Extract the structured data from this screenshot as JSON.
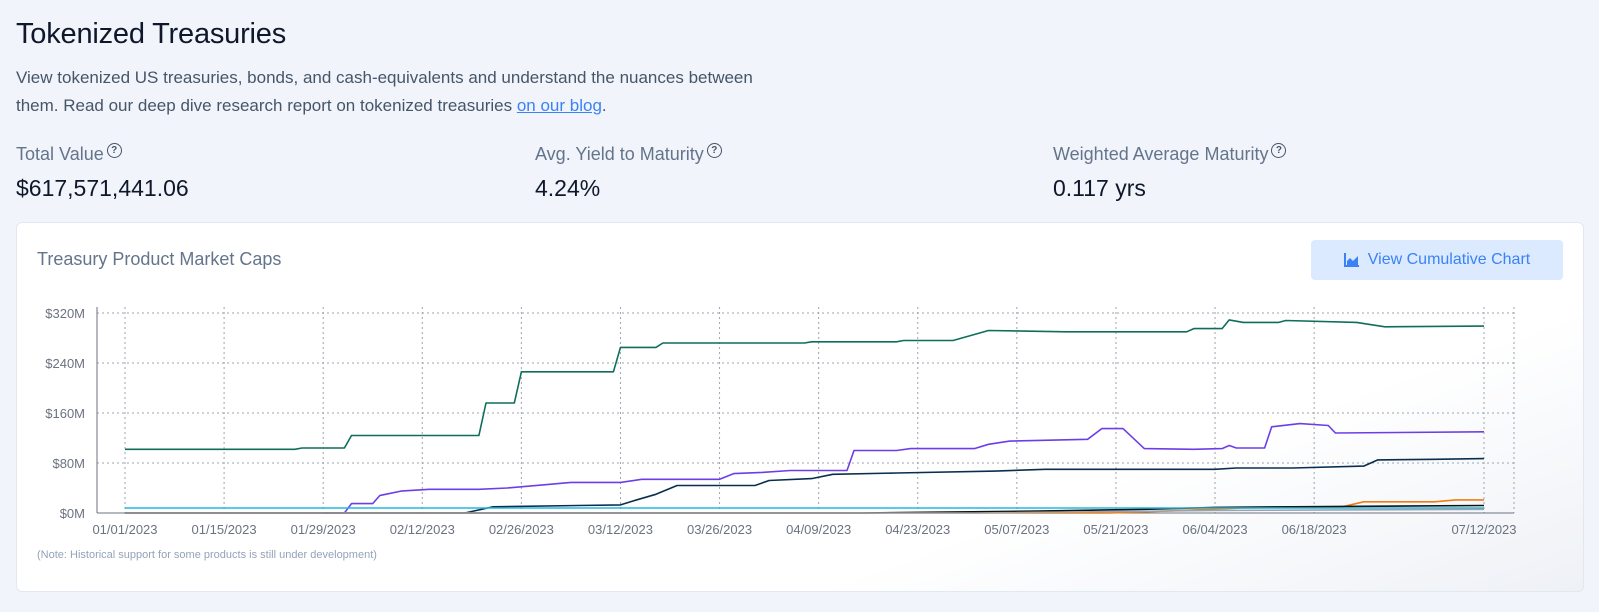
{
  "header": {
    "title": "Tokenized Treasuries",
    "description_prefix": "View tokenized US treasuries, bonds, and cash-equivalents and understand the nuances between them. Read our deep dive research report on tokenized treasuries ",
    "link_text": "on our blog",
    "description_suffix": "."
  },
  "stats": [
    {
      "label": "Total Value",
      "value": "$617,571,441.06"
    },
    {
      "label": "Avg. Yield to Maturity",
      "value": "4.24%"
    },
    {
      "label": "Weighted Average Maturity",
      "value": "0.117 yrs"
    }
  ],
  "help_glyph": "?",
  "card": {
    "title": "Treasury Product Market Caps",
    "cumulative_button": "View Cumulative Chart",
    "note": "(Note: Historical support for some products is still under development)"
  },
  "colors": {
    "accent": "#3b82f6",
    "button_bg": "#dbeafe"
  },
  "chart_data": {
    "type": "line",
    "x_start": "2023-01-01",
    "x_end": "2023-07-12",
    "x_ticks": [
      "01/01/2023",
      "01/15/2023",
      "01/29/2023",
      "02/12/2023",
      "02/26/2023",
      "03/12/2023",
      "03/26/2023",
      "04/09/2023",
      "04/23/2023",
      "05/07/2023",
      "05/21/2023",
      "06/04/2023",
      "06/18/2023",
      "07/12/2023"
    ],
    "x_tick_dates": [
      "2023-01-01",
      "2023-01-15",
      "2023-01-29",
      "2023-02-12",
      "2023-02-26",
      "2023-03-12",
      "2023-03-26",
      "2023-04-09",
      "2023-04-23",
      "2023-05-07",
      "2023-05-21",
      "2023-06-04",
      "2023-06-18",
      "2023-07-12"
    ],
    "y_ticks": [
      0,
      80,
      160,
      240,
      320
    ],
    "y_tick_labels": [
      "$0M",
      "$80M",
      "$160M",
      "$240M",
      "$320M"
    ],
    "ylim": [
      0,
      320
    ],
    "grid": true,
    "series": [
      {
        "color": "#0f6e5a",
        "points": [
          [
            "2023-01-01",
            102
          ],
          [
            "2023-01-25",
            102
          ],
          [
            "2023-01-26",
            104
          ],
          [
            "2023-02-01",
            104
          ],
          [
            "2023-02-02",
            124
          ],
          [
            "2023-02-20",
            124
          ],
          [
            "2023-02-21",
            176
          ],
          [
            "2023-02-25",
            176
          ],
          [
            "2023-02-26",
            226
          ],
          [
            "2023-03-11",
            226
          ],
          [
            "2023-03-12",
            265
          ],
          [
            "2023-03-17",
            265
          ],
          [
            "2023-03-18",
            272
          ],
          [
            "2023-04-07",
            272
          ],
          [
            "2023-04-08",
            274
          ],
          [
            "2023-04-20",
            274
          ],
          [
            "2023-04-21",
            276
          ],
          [
            "2023-04-28",
            276
          ],
          [
            "2023-05-03",
            292
          ],
          [
            "2023-05-14",
            290
          ],
          [
            "2023-05-31",
            290
          ],
          [
            "2023-06-01",
            295
          ],
          [
            "2023-06-05",
            295
          ],
          [
            "2023-06-06",
            309
          ],
          [
            "2023-06-08",
            305
          ],
          [
            "2023-06-13",
            305
          ],
          [
            "2023-06-14",
            308
          ],
          [
            "2023-06-24",
            305
          ],
          [
            "2023-06-28",
            298
          ],
          [
            "2023-07-12",
            299
          ]
        ]
      },
      {
        "color": "#6d3ee8",
        "points": [
          [
            "2023-01-29",
            0
          ],
          [
            "2023-02-01",
            0
          ],
          [
            "2023-02-02",
            15
          ],
          [
            "2023-02-05",
            15
          ],
          [
            "2023-02-06",
            28
          ],
          [
            "2023-02-09",
            35
          ],
          [
            "2023-02-13",
            38
          ],
          [
            "2023-02-20",
            38
          ],
          [
            "2023-02-24",
            40
          ],
          [
            "2023-03-01",
            45
          ],
          [
            "2023-03-05",
            49
          ],
          [
            "2023-03-12",
            49
          ],
          [
            "2023-03-15",
            54
          ],
          [
            "2023-03-26",
            54
          ],
          [
            "2023-03-28",
            63
          ],
          [
            "2023-04-01",
            65
          ],
          [
            "2023-04-05",
            68
          ],
          [
            "2023-04-13",
            68
          ],
          [
            "2023-04-14",
            100
          ],
          [
            "2023-04-20",
            100
          ],
          [
            "2023-04-22",
            103
          ],
          [
            "2023-05-01",
            103
          ],
          [
            "2023-05-03",
            110
          ],
          [
            "2023-05-06",
            115
          ],
          [
            "2023-05-17",
            118
          ],
          [
            "2023-05-19",
            135
          ],
          [
            "2023-05-22",
            135
          ],
          [
            "2023-05-25",
            103
          ],
          [
            "2023-06-01",
            102
          ],
          [
            "2023-06-05",
            103
          ],
          [
            "2023-06-06",
            108
          ],
          [
            "2023-06-07",
            104
          ],
          [
            "2023-06-11",
            104
          ],
          [
            "2023-06-12",
            138
          ],
          [
            "2023-06-16",
            143
          ],
          [
            "2023-06-20",
            140
          ],
          [
            "2023-06-21",
            128
          ],
          [
            "2023-07-12",
            130
          ]
        ]
      },
      {
        "color": "#0b2e4f",
        "points": [
          [
            "2023-01-01",
            0
          ],
          [
            "2023-02-18",
            0
          ],
          [
            "2023-02-22",
            10
          ],
          [
            "2023-03-06",
            12
          ],
          [
            "2023-03-12",
            13
          ],
          [
            "2023-03-14",
            20
          ],
          [
            "2023-03-17",
            30
          ],
          [
            "2023-03-20",
            44
          ],
          [
            "2023-03-31",
            44
          ],
          [
            "2023-04-02",
            52
          ],
          [
            "2023-04-08",
            55
          ],
          [
            "2023-04-11",
            62
          ],
          [
            "2023-04-20",
            64
          ],
          [
            "2023-05-04",
            67
          ],
          [
            "2023-05-11",
            70
          ],
          [
            "2023-06-04",
            70
          ],
          [
            "2023-06-07",
            72
          ],
          [
            "2023-06-15",
            72
          ],
          [
            "2023-06-25",
            75
          ],
          [
            "2023-06-27",
            85
          ],
          [
            "2023-07-05",
            86
          ],
          [
            "2023-07-12",
            87
          ]
        ]
      },
      {
        "color": "#ee7c14",
        "points": [
          [
            "2023-01-01",
            0
          ],
          [
            "2023-05-20",
            0
          ],
          [
            "2023-05-28",
            3
          ],
          [
            "2023-06-08",
            8
          ],
          [
            "2023-06-22",
            10
          ],
          [
            "2023-06-25",
            18
          ],
          [
            "2023-07-05",
            18
          ],
          [
            "2023-07-08",
            21
          ],
          [
            "2023-07-12",
            21
          ]
        ]
      },
      {
        "color": "#111111",
        "points": [
          [
            "2023-01-01",
            0
          ],
          [
            "2023-04-15",
            0
          ],
          [
            "2023-05-10",
            3
          ],
          [
            "2023-05-25",
            6
          ],
          [
            "2023-06-04",
            9
          ],
          [
            "2023-06-15",
            10
          ],
          [
            "2023-07-12",
            12
          ]
        ]
      },
      {
        "color": "#22b8e0",
        "points": [
          [
            "2023-01-01",
            8
          ],
          [
            "2023-07-12",
            8
          ]
        ]
      },
      {
        "color": "#9ca3af",
        "points": [
          [
            "2023-01-01",
            0
          ],
          [
            "2023-05-01",
            0
          ],
          [
            "2023-06-04",
            4
          ],
          [
            "2023-07-12",
            6
          ]
        ]
      }
    ]
  }
}
